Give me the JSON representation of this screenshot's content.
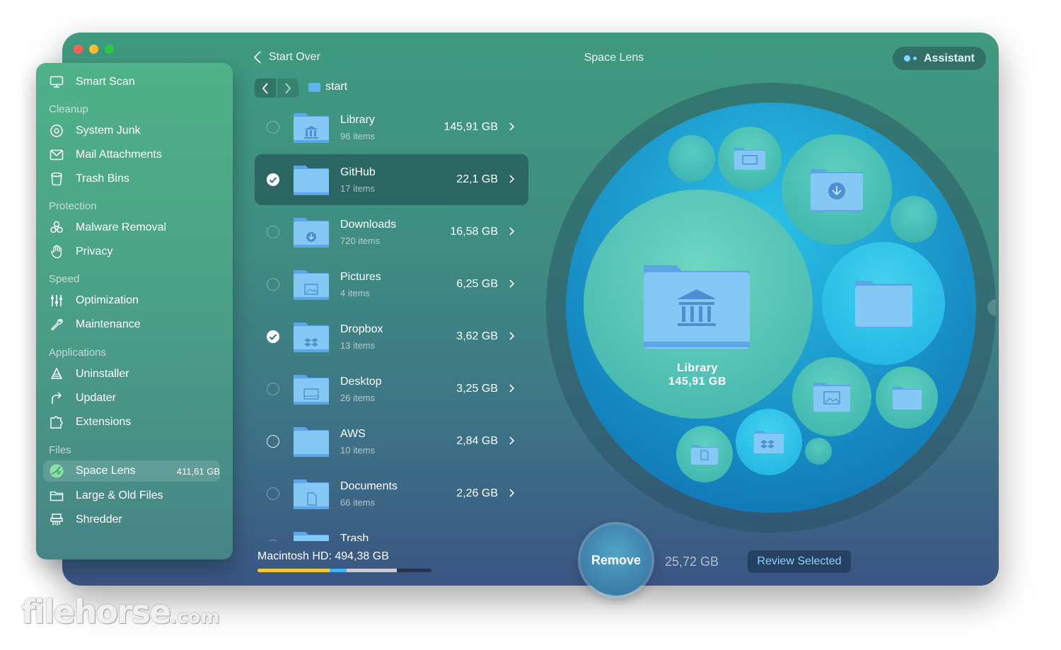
{
  "window": {
    "title": "Space Lens",
    "back_label": "Start Over",
    "assistant_label": "Assistant",
    "breadcrumb": "start"
  },
  "sidebar": {
    "top_item": {
      "label": "Smart Scan",
      "icon": "monitor-icon"
    },
    "sections": [
      {
        "title": "Cleanup",
        "items": [
          {
            "label": "System Junk",
            "icon": "disk-icon"
          },
          {
            "label": "Mail Attachments",
            "icon": "mail-icon"
          },
          {
            "label": "Trash Bins",
            "icon": "trash-icon"
          }
        ]
      },
      {
        "title": "Protection",
        "items": [
          {
            "label": "Malware Removal",
            "icon": "biohazard-icon"
          },
          {
            "label": "Privacy",
            "icon": "hand-icon"
          }
        ]
      },
      {
        "title": "Speed",
        "items": [
          {
            "label": "Optimization",
            "icon": "sliders-icon"
          },
          {
            "label": "Maintenance",
            "icon": "wrench-icon"
          }
        ]
      },
      {
        "title": "Applications",
        "items": [
          {
            "label": "Uninstaller",
            "icon": "apps-icon"
          },
          {
            "label": "Updater",
            "icon": "update-arrow-icon"
          },
          {
            "label": "Extensions",
            "icon": "puzzle-icon"
          }
        ]
      },
      {
        "title": "Files",
        "items": [
          {
            "label": "Space Lens",
            "icon": "lens-icon",
            "size": "411,61 GB",
            "active": true
          },
          {
            "label": "Large & Old Files",
            "icon": "folder-icon"
          },
          {
            "label": "Shredder",
            "icon": "shredder-icon"
          }
        ]
      }
    ]
  },
  "list": {
    "rows": [
      {
        "name": "Library",
        "items": "96 items",
        "size": "145,91 GB",
        "checked": false,
        "icon": "library-icon"
      },
      {
        "name": "GitHub",
        "items": "17 items",
        "size": "22,1 GB",
        "checked": true,
        "selected": true,
        "icon": "plain"
      },
      {
        "name": "Downloads",
        "items": "720 items",
        "size": "16,58 GB",
        "checked": false,
        "icon": "download-icon"
      },
      {
        "name": "Pictures",
        "items": "4 items",
        "size": "6,25 GB",
        "checked": false,
        "icon": "picture-icon"
      },
      {
        "name": "Dropbox",
        "items": "13 items",
        "size": "3,62 GB",
        "checked": true,
        "icon": "dropbox-icon"
      },
      {
        "name": "Desktop",
        "items": "26 items",
        "size": "3,25 GB",
        "checked": false,
        "icon": "desktop-icon"
      },
      {
        "name": "AWS",
        "items": "10 items",
        "size": "2,84 GB",
        "checked": false,
        "strong": true,
        "icon": "plain"
      },
      {
        "name": "Documents",
        "items": "66 items",
        "size": "2,26 GB",
        "checked": false,
        "icon": "document-icon"
      },
      {
        "name": "Trash",
        "items": "",
        "size": "",
        "checked": false,
        "icon": "plain"
      }
    ]
  },
  "disk": {
    "label": "Macintosh HD: 494,38 GB",
    "used_fraction": 0.8,
    "segments": [
      0.52,
      0.4,
      0.08
    ]
  },
  "footer": {
    "remove_label": "Remove",
    "selected_size": "25,72 GB",
    "review_label": "Review Selected"
  },
  "lens": {
    "center_name": "Library",
    "center_size": "145,91 GB"
  },
  "watermark": {
    "text": "filehorse",
    "suffix": ".com"
  },
  "colors": {
    "window_top": "#3f9a7f",
    "window_bottom": "#3a5584",
    "accent": "#8ed2ff",
    "folder": "#7ec6f3"
  }
}
